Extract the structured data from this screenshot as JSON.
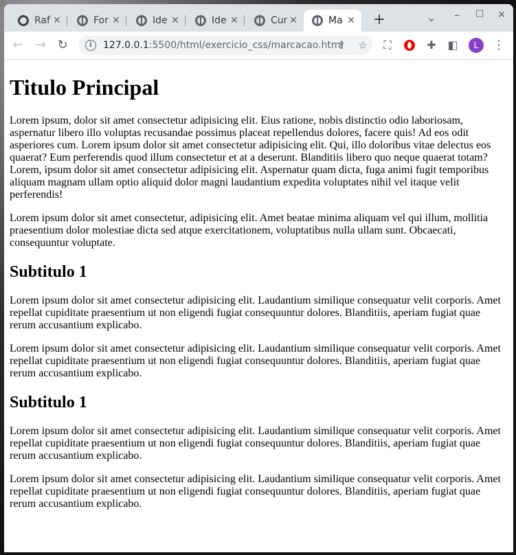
{
  "browser": {
    "tabs": [
      {
        "title": "Raf",
        "icon": "github-icon"
      },
      {
        "title": "For",
        "icon": "globe-icon"
      },
      {
        "title": "Ide",
        "icon": "globe-icon"
      },
      {
        "title": "Ide",
        "icon": "globe-icon"
      },
      {
        "title": "Cur",
        "icon": "globe-icon"
      },
      {
        "title": "Ma",
        "icon": "globe-icon",
        "active": true
      }
    ],
    "new_tab": "+",
    "url_host": "127.0.0.1",
    "url_rest": ":5500/html/exercicio_css/marcacao.html",
    "profile_initial": "L"
  },
  "page": {
    "title": "Titulo Principal",
    "intro_paragraphs": [
      "Lorem ipsum, dolor sit amet consectetur adipisicing elit. Eius ratione, nobis distinctio odio laboriosam, aspernatur libero illo voluptas recusandae possimus placeat repellendus dolores, facere quis! Ad eos odit asperiores cum. Lorem ipsum dolor sit amet consectetur adipisicing elit. Qui, illo doloribus vitae delectus eos quaerat? Eum perferendis quod illum consectetur et at a deserunt. Blanditiis libero quo neque quaerat totam? Lorem, ipsum dolor sit amet consectetur adipisicing elit. Aspernatur quam dicta, fuga animi fugit temporibus aliquam magnam ullam optio aliquid dolor magni laudantium expedita voluptates nihil vel itaque velit perferendis!",
      "Lorem ipsum dolor sit amet consectetur, adipisicing elit. Amet beatae minima aliquam vel qui illum, mollitia praesentium dolor molestiae dicta sed atque exercitationem, voluptatibus nulla ullam sunt. Obcaecati, consequuntur voluptate."
    ],
    "sections": [
      {
        "heading": "Subtitulo 1",
        "paragraphs": [
          "Lorem ipsum dolor sit amet consectetur adipisicing elit. Laudantium similique consequatur velit corporis. Amet repellat cupiditate praesentium ut non eligendi fugiat consequuntur dolores. Blanditiis, aperiam fugiat quae rerum accusantium explicabo.",
          "Lorem ipsum dolor sit amet consectetur adipisicing elit. Laudantium similique consequatur velit corporis. Amet repellat cupiditate praesentium ut non eligendi fugiat consequuntur dolores. Blanditiis, aperiam fugiat quae rerum accusantium explicabo."
        ]
      },
      {
        "heading": "Subtitulo 1",
        "paragraphs": [
          "Lorem ipsum dolor sit amet consectetur adipisicing elit. Laudantium similique consequatur velit corporis. Amet repellat cupiditate praesentium ut non eligendi fugiat consequuntur dolores. Blanditiis, aperiam fugiat quae rerum accusantium explicabo.",
          "Lorem ipsum dolor sit amet consectetur adipisicing elit. Laudantium similique consequatur velit corporis. Amet repellat cupiditate praesentium ut non eligendi fugiat consequuntur dolores. Blanditiis, aperiam fugiat quae rerum accusantium explicabo."
        ]
      }
    ]
  },
  "colors": {
    "tabstrip_bg": "#dee1e6",
    "omnibox_bg": "#f1f3f4",
    "avatar_bg": "#8a3fc7",
    "opera_red": "#e00000"
  }
}
